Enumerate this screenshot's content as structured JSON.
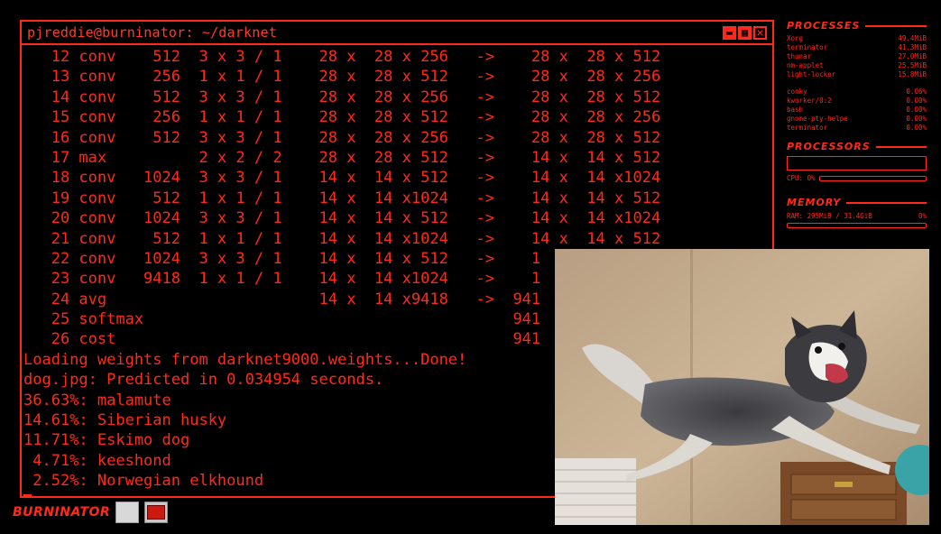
{
  "terminal": {
    "title": "pjreddie@burninator: ~/darknet",
    "lines": [
      "   12 conv    512  3 x 3 / 1    28 x  28 x 256   ->    28 x  28 x 512",
      "   13 conv    256  1 x 1 / 1    28 x  28 x 512   ->    28 x  28 x 256",
      "   14 conv    512  3 x 3 / 1    28 x  28 x 256   ->    28 x  28 x 512",
      "   15 conv    256  1 x 1 / 1    28 x  28 x 512   ->    28 x  28 x 256",
      "   16 conv    512  3 x 3 / 1    28 x  28 x 256   ->    28 x  28 x 512",
      "   17 max          2 x 2 / 2    28 x  28 x 512   ->    14 x  14 x 512",
      "   18 conv   1024  3 x 3 / 1    14 x  14 x 512   ->    14 x  14 x1024",
      "   19 conv    512  1 x 1 / 1    14 x  14 x1024   ->    14 x  14 x 512",
      "   20 conv   1024  3 x 3 / 1    14 x  14 x 512   ->    14 x  14 x1024",
      "   21 conv    512  1 x 1 / 1    14 x  14 x1024   ->    14 x  14 x 512",
      "   22 conv   1024  3 x 3 / 1    14 x  14 x 512   ->    1",
      "   23 conv   9418  1 x 1 / 1    14 x  14 x1024   ->    1",
      "   24 avg                       14 x  14 x9418   ->  941",
      "   25 softmax                                        941",
      "   26 cost                                           941",
      "Loading weights from darknet9000.weights...Done!",
      "dog.jpg: Predicted in 0.034954 seconds.",
      "36.63%: malamute",
      "14.61%: Siberian husky",
      "11.71%: Eskimo dog",
      " 4.71%: keeshond",
      " 2.52%: Norwegian elkhound"
    ]
  },
  "sidebar": {
    "processes_header": "PROCESSES",
    "processes_top": [
      {
        "name": "Xorg",
        "value": "49.4MiB"
      },
      {
        "name": "terminator",
        "value": "41.3MiB"
      },
      {
        "name": "thunar",
        "value": "27.0MiB"
      },
      {
        "name": "nm-applet",
        "value": "25.5MiB"
      },
      {
        "name": "light-locker",
        "value": "15.8MiB"
      }
    ],
    "processes_cpu": [
      {
        "name": "conky",
        "value": "0.06%"
      },
      {
        "name": "kworker/0:2",
        "value": "0.00%"
      },
      {
        "name": "bash",
        "value": "0.00%"
      },
      {
        "name": "gnome-pty-helpe",
        "value": "0.00%"
      },
      {
        "name": "terminator",
        "value": "0.00%"
      }
    ],
    "processors_header": "PROCESSORS",
    "cpu_label": "CPU: 0%",
    "memory_header": "MEMORY",
    "ram_label": "RAM: 295MiB / 31.4GiB",
    "ram_percent": "0%"
  },
  "taskbar": {
    "brand": "BURNINATOR"
  },
  "photo": {
    "icon": "dog-photo"
  },
  "colors": {
    "accent": "#ff2a1a",
    "background": "#000000"
  }
}
